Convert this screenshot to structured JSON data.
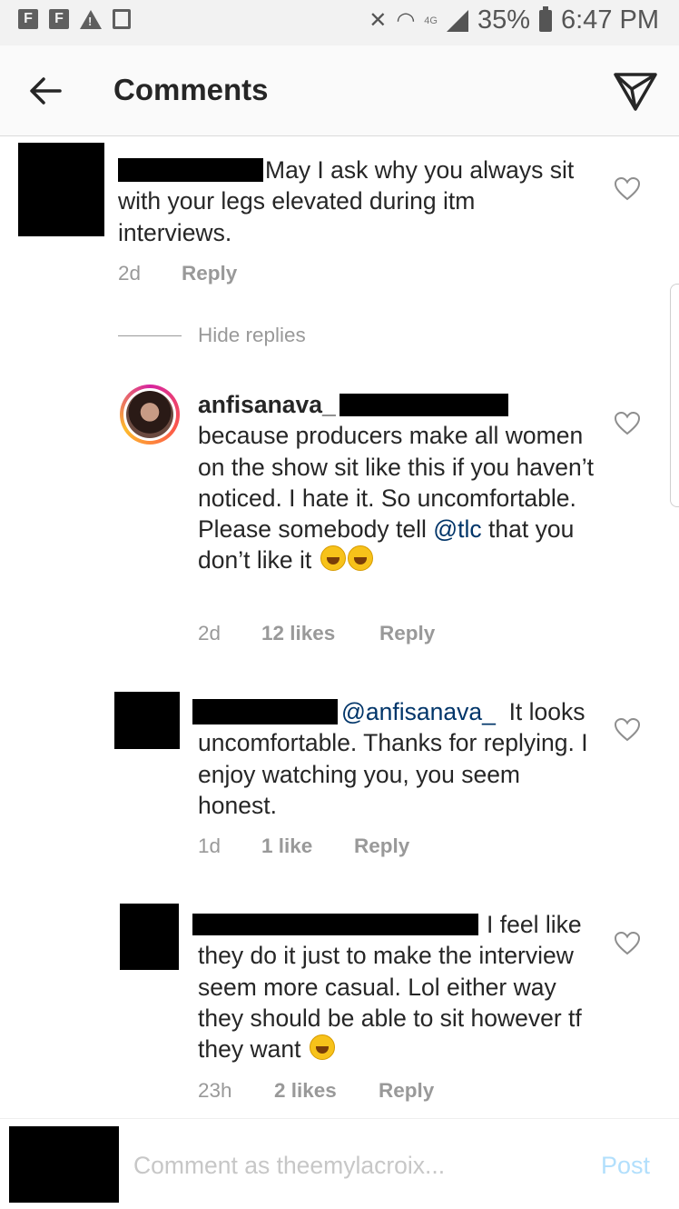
{
  "status_bar": {
    "app_icons": [
      "F",
      "F"
    ],
    "battery": "35%",
    "network": "4G",
    "time": "6:47 PM",
    "icons": [
      "facebook-icon",
      "facebook-icon",
      "warning-icon",
      "screenshot-icon",
      "mute-icon",
      "wifi-icon",
      "signal-icon",
      "battery-icon"
    ]
  },
  "header": {
    "title": "Comments",
    "back_icon": "arrow-left-icon",
    "direct_icon": "paper-plane-icon"
  },
  "comments": [
    {
      "text": "May I ask why you always sit with your legs elevated during itm interviews.",
      "time": "2d",
      "reply_label": "Reply"
    }
  ],
  "hide_replies": "Hide replies",
  "replies": [
    {
      "username": "anfisanava_",
      "text_before_mention": "because producers make all women on the show sit like this if you haven’t noticed. I hate it. So uncomfortable. Please somebody tell ",
      "mention": "@tlc",
      "text_after_mention": " that you don’t like it",
      "time": "2d",
      "likes": "12 likes",
      "reply_label": "Reply"
    },
    {
      "mention": "@anfisanava_",
      "text": "It looks uncomfortable. Thanks for replying. I enjoy watching you, you seem honest.",
      "time": "1d",
      "likes": "1 like",
      "reply_label": "Reply"
    },
    {
      "text": "I feel like they do it just to make the interview seem more casual. Lol either way they should be able to sit however tf they want",
      "time": "23h",
      "likes": "2 likes",
      "reply_label": "Reply"
    }
  ],
  "composer": {
    "placeholder": "Comment as theemylacroix...",
    "post_label": "Post"
  },
  "colors": {
    "mention": "#003569",
    "post_disabled": "#b2dffc",
    "meta": "#999999"
  }
}
